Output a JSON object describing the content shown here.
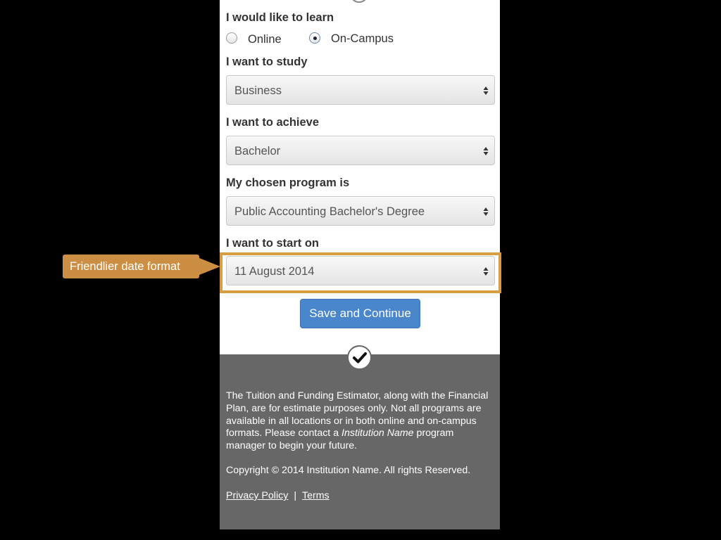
{
  "form": {
    "learn_label": "I would like to learn",
    "learn_options": [
      {
        "label": "Online",
        "selected": false
      },
      {
        "label": "On-Campus",
        "selected": true
      }
    ],
    "study_label": "I want to study",
    "study_value": "Business",
    "achieve_label": "I want to achieve",
    "achieve_value": "Bachelor",
    "program_label": "My chosen program is",
    "program_value": "Public Accounting Bachelor's Degree",
    "start_label": "I want to start on",
    "start_value": "11 August 2014",
    "submit_label": "Save and Continue"
  },
  "annotation": {
    "callout_text": "Friendlier date format",
    "color": "#cc8e42"
  },
  "footer": {
    "disclaimer_part1": "The Tuition and Funding Estimator, along with the Financial Plan, are for estimate purposes only. Not all programs are available in all locations or in both online and on-campus formats. Please contact a ",
    "disclaimer_italic": "Institution Name",
    "disclaimer_part2": " program manager to begin your future.",
    "copyright": "Copyright © 2014 Institution Name. All rights Reserved.",
    "privacy_link": "Privacy Policy",
    "separator": "|",
    "terms_link": "Terms"
  },
  "colors": {
    "primary_button": "#4a86cc",
    "footer_bg": "#676767",
    "highlight_border": "#d99e42"
  }
}
